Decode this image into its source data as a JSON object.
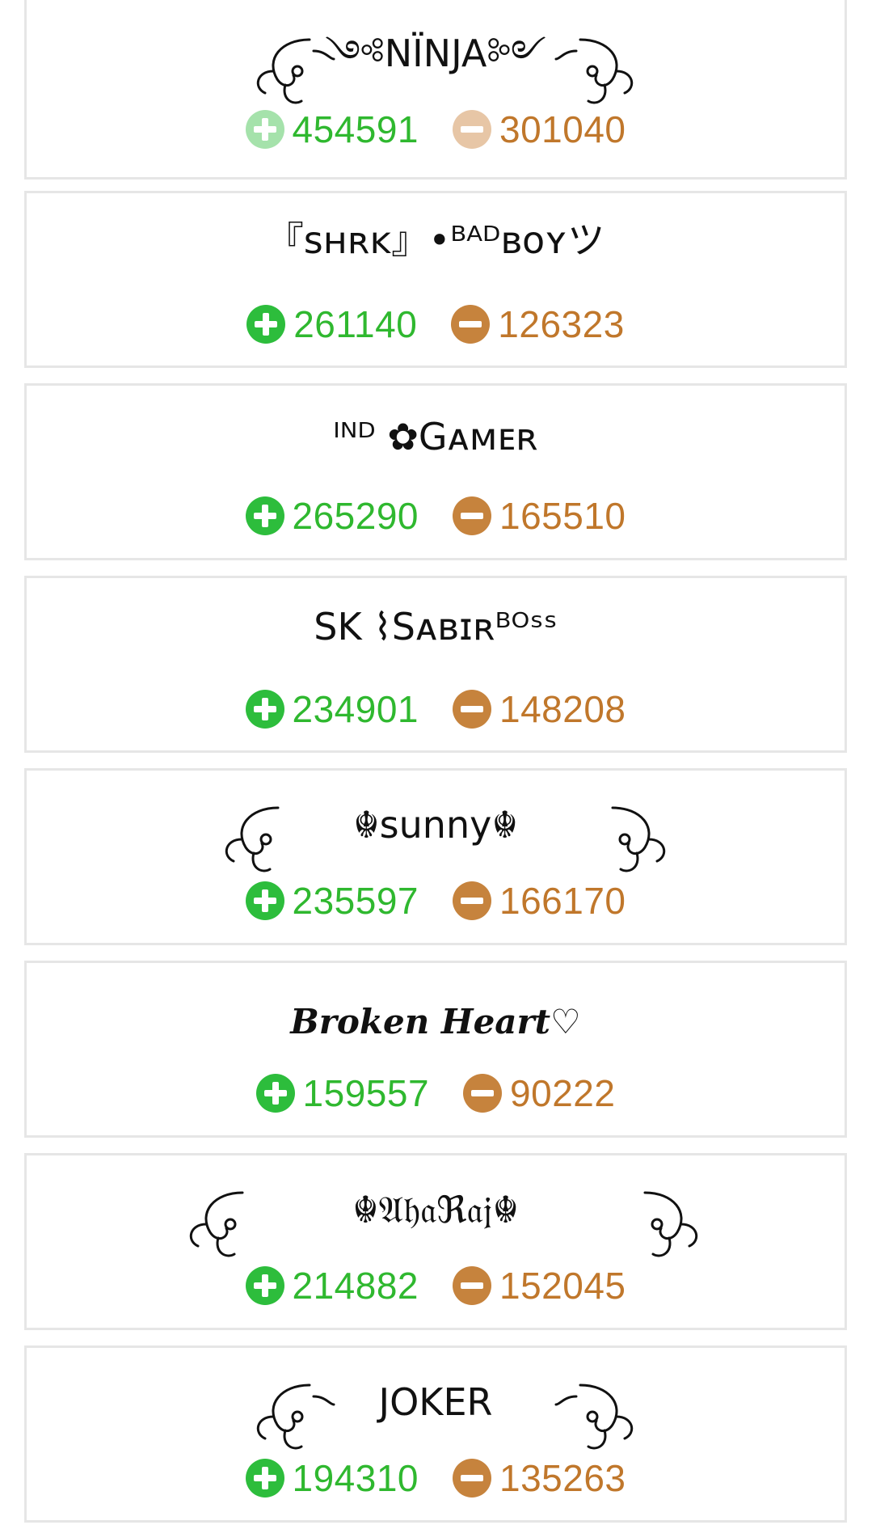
{
  "entries": [
    {
      "name": "༺NÏNJA༻",
      "up": "454591",
      "down": "301040",
      "faded": true
    },
    {
      "name": "『ꜱʜʀᴋ』•ᴮᴬᴰʙᴏʏツ",
      "up": "261140",
      "down": "126323"
    },
    {
      "name": "ᴵᴺᴰ ✿Gᴀᴍᴇʀ",
      "up": "265290",
      "down": "165510"
    },
    {
      "name": "SK ⌇Sᴀʙɪʀᴮᴼˢˢ",
      "up": "234901",
      "down": "148208"
    },
    {
      "name": "☬sunny☬",
      "up": "235597",
      "down": "166170"
    },
    {
      "name": "Broken Heart♡",
      "up": "159557",
      "down": "90222"
    },
    {
      "name": "☬𝔄𝔥𝔞ℜ𝔞𝔧☬",
      "up": "214882",
      "down": "152045"
    },
    {
      "name": "JOKER",
      "up": "194310",
      "down": "135263"
    }
  ]
}
